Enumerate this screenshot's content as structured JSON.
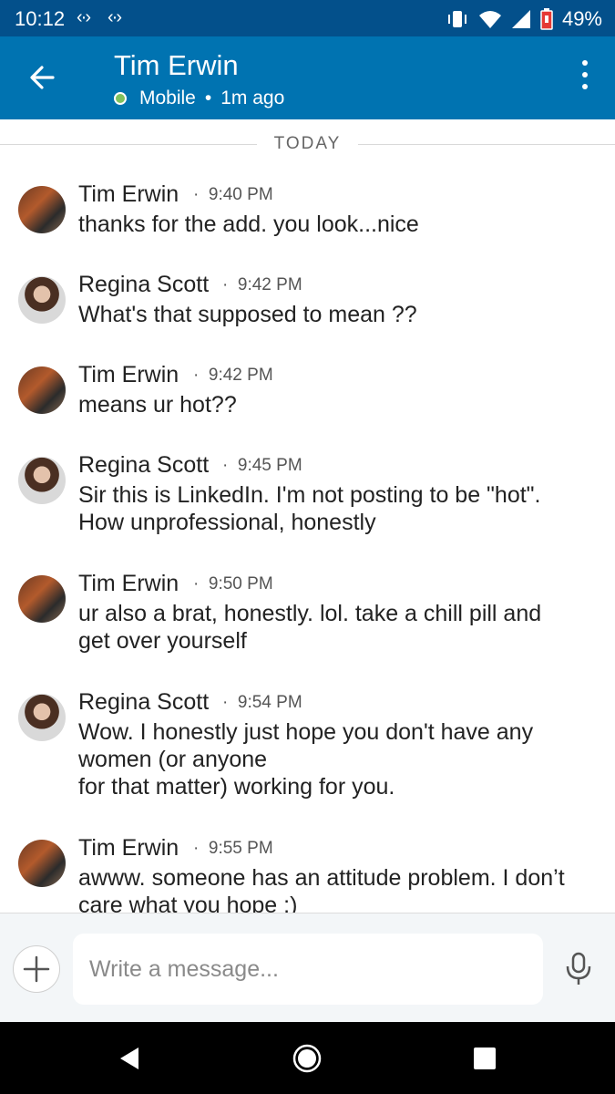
{
  "status_bar": {
    "time": "10:12",
    "battery": "49%"
  },
  "header": {
    "name": "Tim Erwin",
    "presence": "Mobile",
    "last_seen": "1m ago"
  },
  "divider": "TODAY",
  "messages": [
    {
      "sender": "Tim Erwin",
      "time": "9:40 PM",
      "text": "thanks for the add. you look...nice"
    },
    {
      "sender": "Regina Scott",
      "time": "9:42 PM",
      "text": "What's that supposed to mean ??"
    },
    {
      "sender": "Tim Erwin",
      "time": "9:42 PM",
      "text": "means ur hot??"
    },
    {
      "sender": "Regina Scott",
      "time": "9:45 PM",
      "text": "Sir this is LinkedIn.  I'm not posting to be \"hot\".\nHow unprofessional,  honestly"
    },
    {
      "sender": "Tim Erwin",
      "time": "9:50 PM",
      "text": "ur also a brat, honestly. lol. take a chill pill and\nget over yourself"
    },
    {
      "sender": "Regina Scott",
      "time": "9:54 PM",
      "text": "Wow. I honestly just hope you don't have any\nwomen (or anyone\n for that matter) working for you."
    },
    {
      "sender": "Tim Erwin",
      "time": "9:55 PM",
      "text": "awww. someone has an attitude problem. I don’t\ncare what you hope :)"
    }
  ],
  "composer": {
    "placeholder": "Write a message..."
  }
}
